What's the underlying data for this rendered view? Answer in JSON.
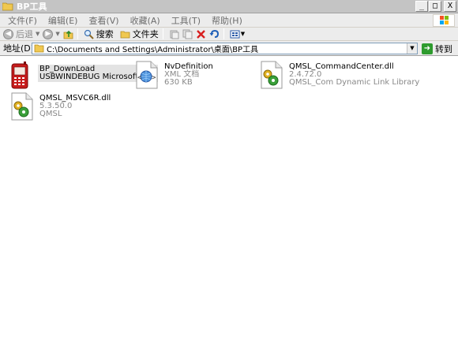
{
  "window": {
    "title": "BP工具",
    "controls": {
      "minimize": "_",
      "maximize": "□",
      "close": "X"
    }
  },
  "menu": [
    "文件(F)",
    "编辑(E)",
    "查看(V)",
    "收藏(A)",
    "工具(T)",
    "帮助(H)"
  ],
  "toolbar": {
    "back_label": "后退",
    "search_label": "搜索",
    "folders_label": "文件夹"
  },
  "address": {
    "label": "地址(D)",
    "path": "C:\\Documents and Settings\\Administrator\\桌面\\BP工具",
    "go_label": "转到"
  },
  "files": [
    {
      "name": "BP_DownLoad",
      "line2": "USBWINDEBUG Microsoft 基...",
      "line3": "",
      "icon": "phone-app-icon"
    },
    {
      "name": "NvDefinition",
      "line2": "XML 文档",
      "line3": "630 KB",
      "icon": "xml-document-icon"
    },
    {
      "name": "QMSL_CommandCenter.dll",
      "line2": "2.4.72.0",
      "line3": "QMSL_Com Dynamic Link Library",
      "icon": "dll-gear-icon"
    },
    {
      "name": "QMSL_MSVC6R.dll",
      "line2": "5.3.50.0",
      "line3": "QMSL",
      "icon": "dll-gear-icon"
    }
  ]
}
